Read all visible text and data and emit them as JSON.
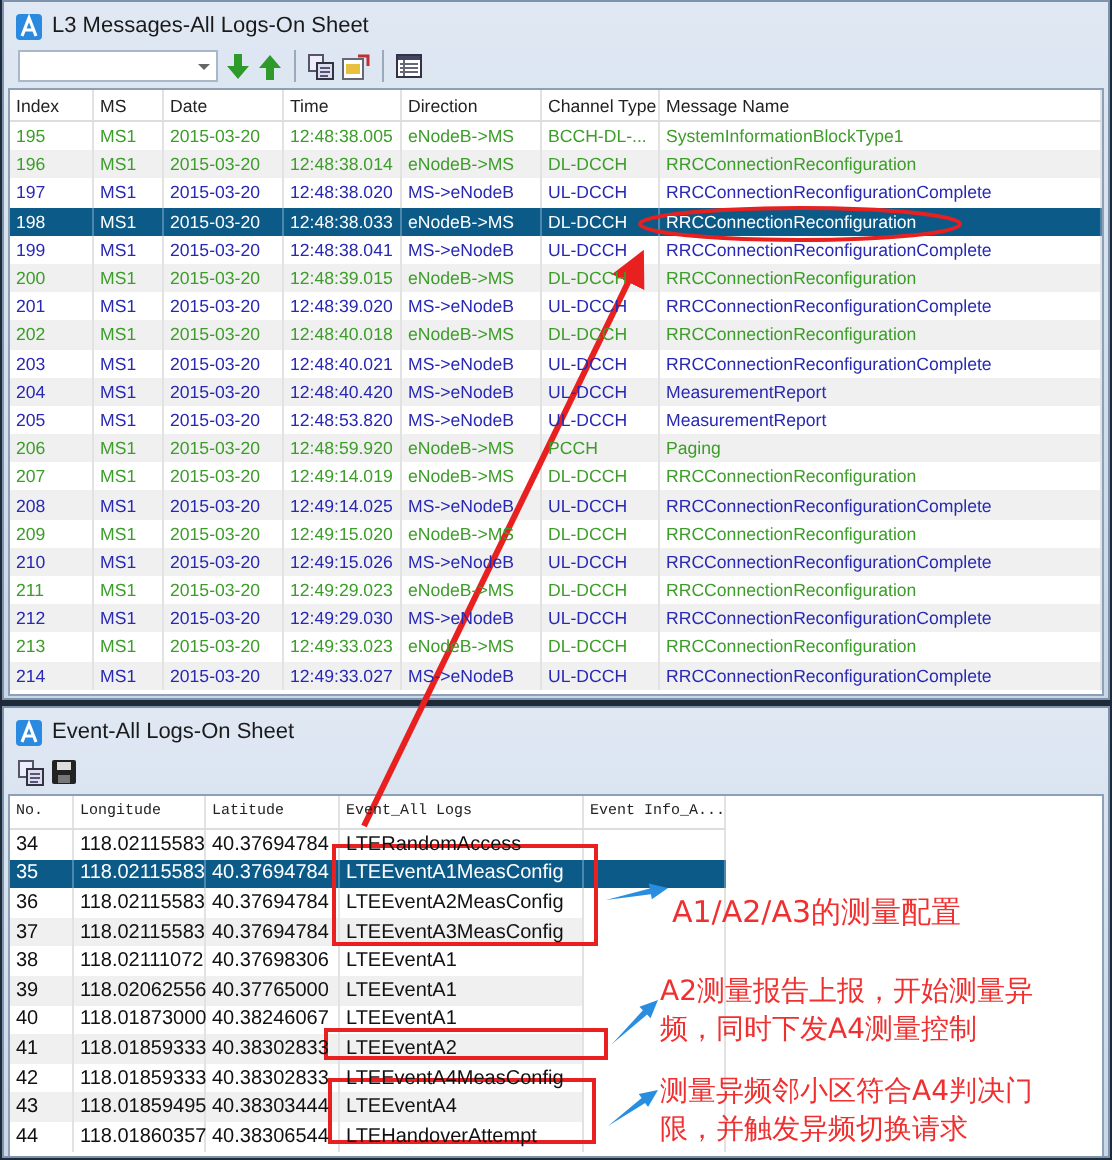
{
  "l3_window": {
    "title": "L3 Messages-All Logs-On Sheet",
    "columns": [
      "Index",
      "MS",
      "Date",
      "Time",
      "Direction",
      "Channel Type",
      "Message Name"
    ],
    "rows": [
      {
        "index": "195",
        "ms": "MS1",
        "date": "2015-03-20",
        "time": "12:48:38.005",
        "direction": "eNodeB->MS",
        "channel_type": "BCCH-DL-...",
        "message_name": "SystemInformationBlockType1",
        "color": "#3c9d28",
        "selected": false
      },
      {
        "index": "196",
        "ms": "MS1",
        "date": "2015-03-20",
        "time": "12:48:38.014",
        "direction": "eNodeB->MS",
        "channel_type": "DL-DCCH",
        "message_name": "RRCConnectionReconfiguration",
        "color": "#3c9d28",
        "selected": false
      },
      {
        "index": "197",
        "ms": "MS1",
        "date": "2015-03-20",
        "time": "12:48:38.020",
        "direction": "MS->eNodeB",
        "channel_type": "UL-DCCH",
        "message_name": "RRCConnectionReconfigurationComplete",
        "color": "#2828b4",
        "selected": false
      },
      {
        "index": "198",
        "ms": "MS1",
        "date": "2015-03-20",
        "time": "12:48:38.033",
        "direction": "eNodeB->MS",
        "channel_type": "DL-DCCH",
        "message_name": "RRCConnectionReconfiguration",
        "selected": true
      },
      {
        "index": "199",
        "ms": "MS1",
        "date": "2015-03-20",
        "time": "12:48:38.041",
        "direction": "MS->eNodeB",
        "channel_type": "UL-DCCH",
        "message_name": "RRCConnectionReconfigurationComplete",
        "color": "#2828b4",
        "selected": false
      },
      {
        "index": "200",
        "ms": "MS1",
        "date": "2015-03-20",
        "time": "12:48:39.015",
        "direction": "eNodeB->MS",
        "channel_type": "DL-DCCH",
        "message_name": "RRCConnectionReconfiguration",
        "color": "#3c9d28",
        "selected": false
      },
      {
        "index": "201",
        "ms": "MS1",
        "date": "2015-03-20",
        "time": "12:48:39.020",
        "direction": "MS->eNodeB",
        "channel_type": "UL-DCCH",
        "message_name": "RRCConnectionReconfigurationComplete",
        "color": "#2828b4",
        "selected": false
      },
      {
        "index": "202",
        "ms": "MS1",
        "date": "2015-03-20",
        "time": "12:48:40.018",
        "direction": "eNodeB->MS",
        "channel_type": "DL-DCCH",
        "message_name": "RRCConnectionReconfiguration",
        "color": "#3c9d28",
        "selected": false
      },
      {
        "index": "203",
        "ms": "MS1",
        "date": "2015-03-20",
        "time": "12:48:40.021",
        "direction": "MS->eNodeB",
        "channel_type": "UL-DCCH",
        "message_name": "RRCConnectionReconfigurationComplete",
        "color": "#2828b4",
        "selected": false
      },
      {
        "index": "204",
        "ms": "MS1",
        "date": "2015-03-20",
        "time": "12:48:40.420",
        "direction": "MS->eNodeB",
        "channel_type": "UL-DCCH",
        "message_name": "MeasurementReport",
        "color": "#2828b4",
        "selected": false
      },
      {
        "index": "205",
        "ms": "MS1",
        "date": "2015-03-20",
        "time": "12:48:53.820",
        "direction": "MS->eNodeB",
        "channel_type": "UL-DCCH",
        "message_name": "MeasurementReport",
        "color": "#2828b4",
        "selected": false
      },
      {
        "index": "206",
        "ms": "MS1",
        "date": "2015-03-20",
        "time": "12:48:59.920",
        "direction": "eNodeB->MS",
        "channel_type": "PCCH",
        "message_name": "Paging",
        "color": "#3c9d28",
        "selected": false
      },
      {
        "index": "207",
        "ms": "MS1",
        "date": "2015-03-20",
        "time": "12:49:14.019",
        "direction": "eNodeB->MS",
        "channel_type": "DL-DCCH",
        "message_name": "RRCConnectionReconfiguration",
        "color": "#3c9d28",
        "selected": false
      },
      {
        "index": "208",
        "ms": "MS1",
        "date": "2015-03-20",
        "time": "12:49:14.025",
        "direction": "MS->eNodeB",
        "channel_type": "UL-DCCH",
        "message_name": "RRCConnectionReconfigurationComplete",
        "color": "#2828b4",
        "selected": false
      },
      {
        "index": "209",
        "ms": "MS1",
        "date": "2015-03-20",
        "time": "12:49:15.020",
        "direction": "eNodeB->MS",
        "channel_type": "DL-DCCH",
        "message_name": "RRCConnectionReconfiguration",
        "color": "#3c9d28",
        "selected": false
      },
      {
        "index": "210",
        "ms": "MS1",
        "date": "2015-03-20",
        "time": "12:49:15.026",
        "direction": "MS->eNodeB",
        "channel_type": "UL-DCCH",
        "message_name": "RRCConnectionReconfigurationComplete",
        "color": "#2828b4",
        "selected": false
      },
      {
        "index": "211",
        "ms": "MS1",
        "date": "2015-03-20",
        "time": "12:49:29.023",
        "direction": "eNodeB->MS",
        "channel_type": "DL-DCCH",
        "message_name": "RRCConnectionReconfiguration",
        "color": "#3c9d28",
        "selected": false
      },
      {
        "index": "212",
        "ms": "MS1",
        "date": "2015-03-20",
        "time": "12:49:29.030",
        "direction": "MS->eNodeB",
        "channel_type": "UL-DCCH",
        "message_name": "RRCConnectionReconfigurationComplete",
        "color": "#2828b4",
        "selected": false
      },
      {
        "index": "213",
        "ms": "MS1",
        "date": "2015-03-20",
        "time": "12:49:33.023",
        "direction": "eNodeB->MS",
        "channel_type": "DL-DCCH",
        "message_name": "RRCConnectionReconfiguration",
        "color": "#3c9d28",
        "selected": false
      },
      {
        "index": "214",
        "ms": "MS1",
        "date": "2015-03-20",
        "time": "12:49:33.027",
        "direction": "MS->eNodeB",
        "channel_type": "UL-DCCH",
        "message_name": "RRCConnectionReconfigurationComplete",
        "color": "#2828b4",
        "selected": false
      }
    ]
  },
  "event_window": {
    "title": "Event-All Logs-On Sheet",
    "columns": [
      "No.",
      "Longitude",
      "Latitude",
      "Event_All Logs",
      "Event Info_A..."
    ],
    "rows": [
      {
        "no": "34",
        "longitude": "118.02115583",
        "latitude": "40.37694784",
        "event": "LTERandomAccess",
        "selected": false
      },
      {
        "no": "35",
        "longitude": "118.02115583",
        "latitude": "40.37694784",
        "event": "LTEEventA1MeasConfig",
        "selected": true
      },
      {
        "no": "36",
        "longitude": "118.02115583",
        "latitude": "40.37694784",
        "event": "LTEEventA2MeasConfig",
        "selected": false
      },
      {
        "no": "37",
        "longitude": "118.02115583",
        "latitude": "40.37694784",
        "event": "LTEEventA3MeasConfig",
        "selected": false
      },
      {
        "no": "38",
        "longitude": "118.02111072",
        "latitude": "40.37698306",
        "event": "LTEEventA1",
        "selected": false
      },
      {
        "no": "39",
        "longitude": "118.02062556",
        "latitude": "40.37765000",
        "event": "LTEEventA1",
        "selected": false
      },
      {
        "no": "40",
        "longitude": "118.01873000",
        "latitude": "40.38246067",
        "event": "LTEEventA1",
        "selected": false
      },
      {
        "no": "41",
        "longitude": "118.01859333",
        "latitude": "40.38302833",
        "event": "LTEEventA2",
        "selected": false
      },
      {
        "no": "42",
        "longitude": "118.01859333",
        "latitude": "40.38302833",
        "event": "LTEEventA4MeasConfig",
        "selected": false
      },
      {
        "no": "43",
        "longitude": "118.01859495",
        "latitude": "40.38303444",
        "event": "LTEEventA4",
        "selected": false
      },
      {
        "no": "44",
        "longitude": "118.01860357",
        "latitude": "40.38306544",
        "event": "LTEHandoverAttempt",
        "selected": false
      }
    ]
  },
  "annotations": [
    {
      "text": "A1/A2/A3的测量配置"
    },
    {
      "text": "A2测量报告上报，开始测量异频，同时下发A4测量控制"
    },
    {
      "text": "测量异频邻小区符合A4判决门限，并触发异频切换请求"
    }
  ]
}
